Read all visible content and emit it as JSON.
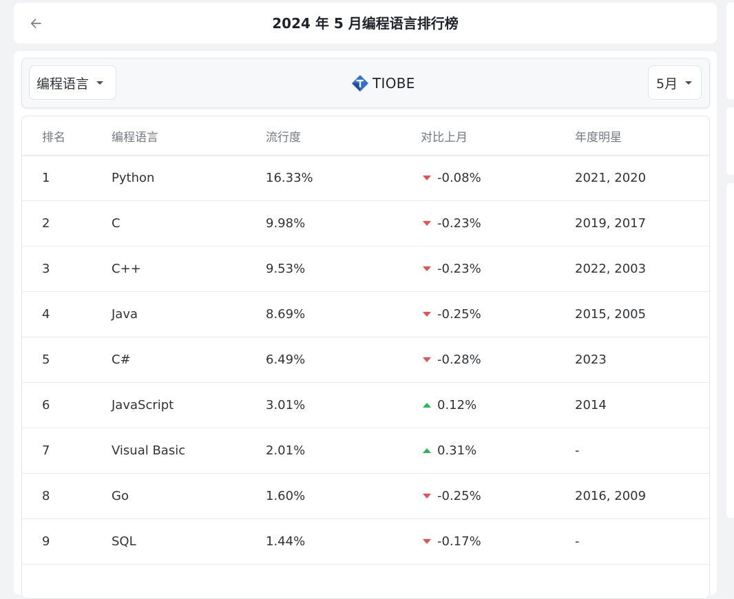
{
  "header": {
    "title": "2024 年 5 月编程语言排行榜"
  },
  "toolbar": {
    "language_select": "编程语言",
    "brand": "TIOBE",
    "month_select": "5月"
  },
  "colors": {
    "down": "#f04d4d",
    "up": "#22bb55",
    "brand_blue": "#2f6fcf"
  },
  "table": {
    "columns": [
      "排名",
      "编程语言",
      "流行度",
      "对比上月",
      "年度明星"
    ],
    "rows": [
      {
        "rank": "1",
        "language": "Python",
        "popularity": "16.33%",
        "trend": "down",
        "change": "-0.08%",
        "stars": "2021, 2020"
      },
      {
        "rank": "2",
        "language": "C",
        "popularity": "9.98%",
        "trend": "down",
        "change": "-0.23%",
        "stars": "2019, 2017"
      },
      {
        "rank": "3",
        "language": "C++",
        "popularity": "9.53%",
        "trend": "down",
        "change": "-0.23%",
        "stars": "2022, 2003"
      },
      {
        "rank": "4",
        "language": "Java",
        "popularity": "8.69%",
        "trend": "down",
        "change": "-0.25%",
        "stars": "2015, 2005"
      },
      {
        "rank": "5",
        "language": "C#",
        "popularity": "6.49%",
        "trend": "down",
        "change": "-0.28%",
        "stars": "2023"
      },
      {
        "rank": "6",
        "language": "JavaScript",
        "popularity": "3.01%",
        "trend": "up",
        "change": "0.12%",
        "stars": "2014"
      },
      {
        "rank": "7",
        "language": "Visual Basic",
        "popularity": "2.01%",
        "trend": "up",
        "change": "0.31%",
        "stars": "-"
      },
      {
        "rank": "8",
        "language": "Go",
        "popularity": "1.60%",
        "trend": "down",
        "change": "-0.25%",
        "stars": "2016, 2009"
      },
      {
        "rank": "9",
        "language": "SQL",
        "popularity": "1.44%",
        "trend": "down",
        "change": "-0.17%",
        "stars": "-"
      }
    ]
  }
}
